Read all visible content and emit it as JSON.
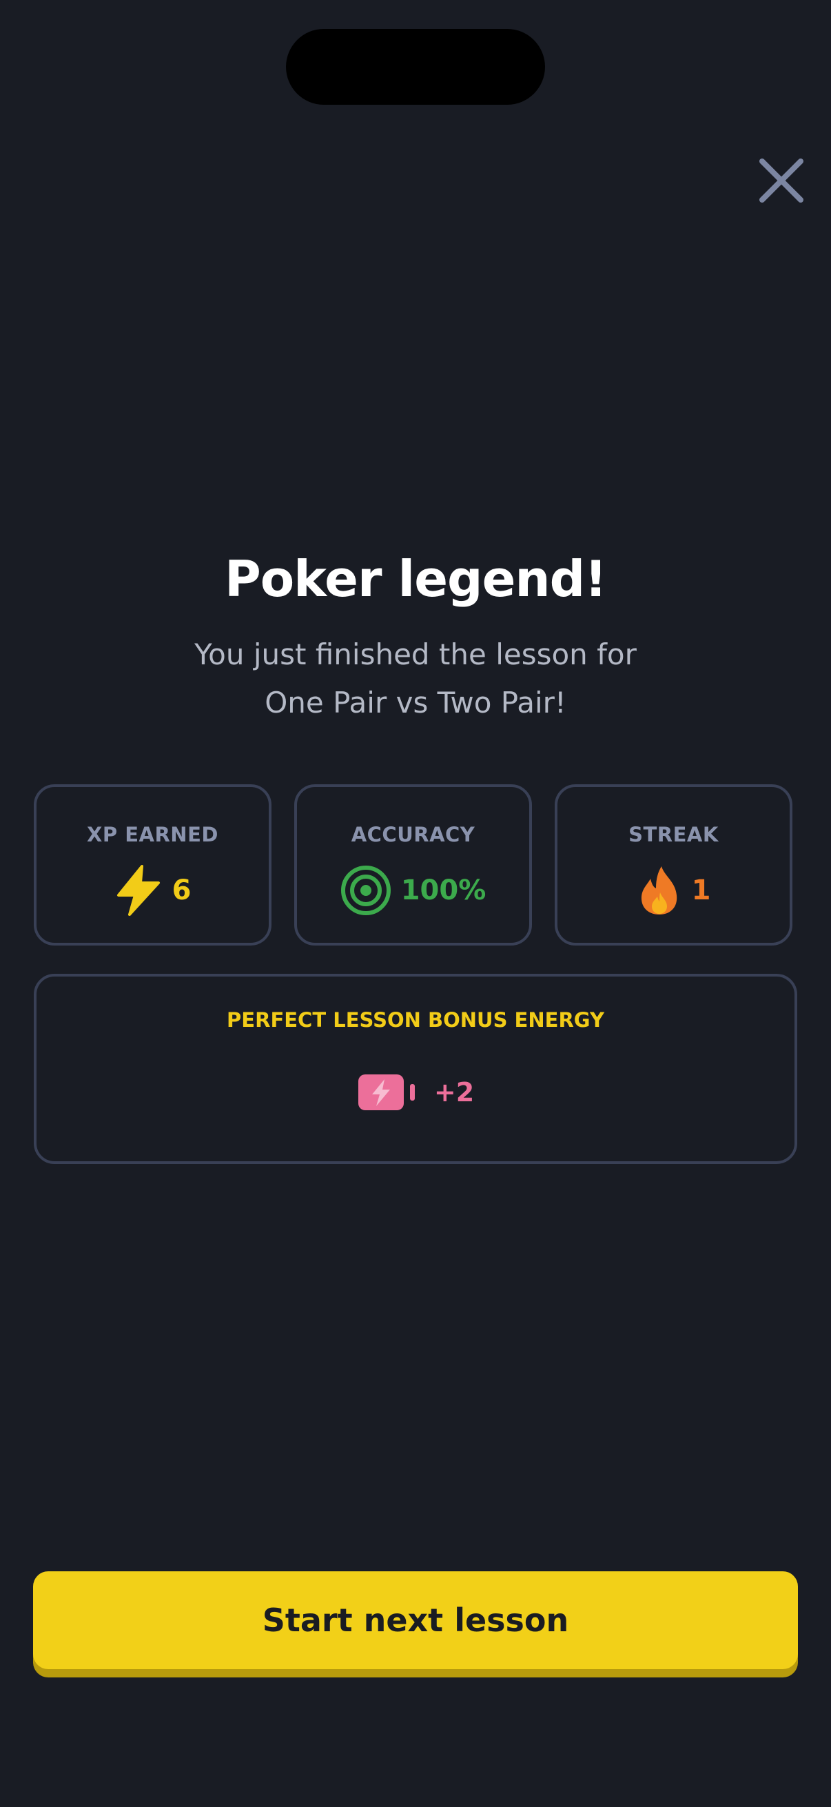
{
  "header": {
    "close_icon": "close-icon"
  },
  "completion": {
    "title": "Poker legend!",
    "subtitle_line1": "You just finished the lesson for",
    "subtitle_line2": "One Pair vs Two Pair!"
  },
  "stats": {
    "xp": {
      "label": "XP EARNED",
      "value": "6",
      "icon": "lightning-bolt-icon",
      "color": "#f2cc18"
    },
    "accuracy": {
      "label": "ACCURACY",
      "value": "100%",
      "icon": "target-icon",
      "color": "#3caa4c"
    },
    "streak": {
      "label": "STREAK",
      "value": "1",
      "icon": "flame-icon",
      "color": "#ef7a25"
    }
  },
  "bonus": {
    "label": "PERFECT LESSON BONUS ENERGY",
    "value": "+2",
    "icon": "energy-battery-icon",
    "color": "#ec6f9a"
  },
  "actions": {
    "primary_label": "Start next lesson",
    "primary_color": "#f2d018"
  }
}
